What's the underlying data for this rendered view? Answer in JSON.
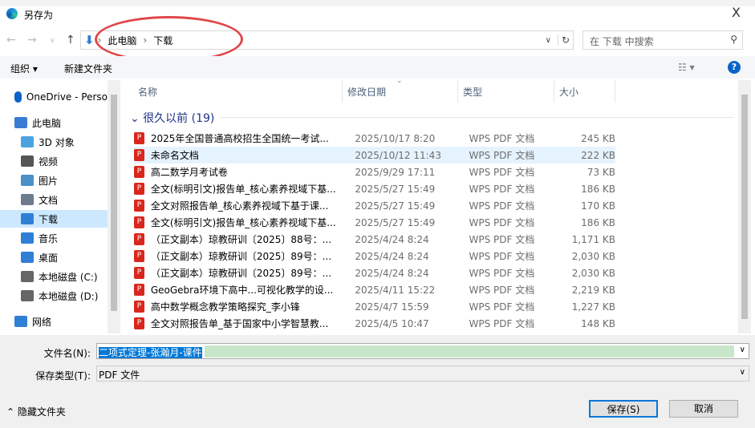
{
  "window": {
    "title": "另存为",
    "close": "X"
  },
  "address": {
    "crumbs": [
      "此电脑",
      "下载"
    ],
    "search_placeholder": "在 下载 中搜索"
  },
  "toolbar": {
    "organize": "组织 ▾",
    "new_folder": "新建文件夹"
  },
  "sidebar": {
    "items": [
      {
        "label": "OneDrive - Perso",
        "icon": "cloud-icon",
        "color": "#0a64c8"
      },
      {
        "label": "此电脑",
        "icon": "computer-icon",
        "color": "#3a7bd5"
      },
      {
        "label": "3D 对象",
        "icon": "cube-icon",
        "color": "#4aa3df"
      },
      {
        "label": "视频",
        "icon": "video-icon",
        "color": "#555"
      },
      {
        "label": "图片",
        "icon": "picture-icon",
        "color": "#4a90c8"
      },
      {
        "label": "文档",
        "icon": "document-icon",
        "color": "#6d7b8d"
      },
      {
        "label": "下载",
        "icon": "download-icon",
        "color": "#2f7fd6",
        "selected": true
      },
      {
        "label": "音乐",
        "icon": "music-icon",
        "color": "#2f7fd6"
      },
      {
        "label": "桌面",
        "icon": "desktop-icon",
        "color": "#2f7fd6"
      },
      {
        "label": "本地磁盘 (C:)",
        "icon": "drive-icon",
        "color": "#666"
      },
      {
        "label": "本地磁盘 (D:)",
        "icon": "drive-icon",
        "color": "#666"
      },
      {
        "label": "网络",
        "icon": "network-icon",
        "color": "#2f7fd6"
      }
    ]
  },
  "columns": {
    "name": "名称",
    "date": "修改日期",
    "type": "类型",
    "size": "大小"
  },
  "group": {
    "label": "很久以前 (19)"
  },
  "files": [
    {
      "name": "2025年全国普通高校招生全国统一考试...",
      "date": "2025/10/17 8:20",
      "type": "WPS PDF 文档",
      "size": "245 KB"
    },
    {
      "name": "未命名文档",
      "date": "2025/10/12 11:43",
      "type": "WPS PDF 文档",
      "size": "222 KB",
      "hover": true
    },
    {
      "name": "高二数学月考试卷",
      "date": "2025/9/29 17:11",
      "type": "WPS PDF 文档",
      "size": "73 KB"
    },
    {
      "name": "全文(标明引文)报告单_核心素养视域下基...",
      "date": "2025/5/27 15:49",
      "type": "WPS PDF 文档",
      "size": "186 KB"
    },
    {
      "name": "全文对照报告单_核心素养视域下基于课...",
      "date": "2025/5/27 15:49",
      "type": "WPS PDF 文档",
      "size": "170 KB"
    },
    {
      "name": "全文(标明引文)报告单_核心素养视域下基...",
      "date": "2025/5/27 15:49",
      "type": "WPS PDF 文档",
      "size": "186 KB"
    },
    {
      "name": "（正文副本）琼教研训〔2025〕88号：...",
      "date": "2025/4/24 8:24",
      "type": "WPS PDF 文档",
      "size": "1,171 KB"
    },
    {
      "name": "（正文副本）琼教研训〔2025〕89号：...",
      "date": "2025/4/24 8:24",
      "type": "WPS PDF 文档",
      "size": "2,030 KB"
    },
    {
      "name": "（正文副本）琼教研训〔2025〕89号：...",
      "date": "2025/4/24 8:24",
      "type": "WPS PDF 文档",
      "size": "2,030 KB"
    },
    {
      "name": "GeoGebra环境下高中...可视化教学的设...",
      "date": "2025/4/11 15:22",
      "type": "WPS PDF 文档",
      "size": "2,219 KB"
    },
    {
      "name": "高中数学概念教学策略探究_李小锋",
      "date": "2025/4/7 15:59",
      "type": "WPS PDF 文档",
      "size": "1,227 KB"
    },
    {
      "name": "全文对照报告单_基于国家中小学智慧教...",
      "date": "2025/4/5 10:47",
      "type": "WPS PDF 文档",
      "size": "148 KB"
    }
  ],
  "form": {
    "filename_label": "文件名(N):",
    "filename_value": "二项式定理-张瀚月-课件",
    "type_label": "保存类型(T):",
    "type_value": "PDF 文件"
  },
  "footer": {
    "hide_folders": "隐藏文件夹",
    "save": "保存(S)",
    "cancel": "取消"
  },
  "colors": {
    "selection": "#cce8ff",
    "annotation": "#e0474a",
    "accent": "#0a64c8"
  }
}
